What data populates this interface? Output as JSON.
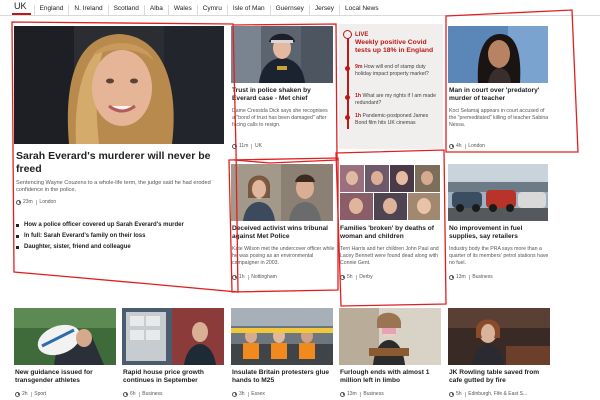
{
  "nav": {
    "current": "UK",
    "items": [
      "England",
      "N. Ireland",
      "Scotland",
      "Alba",
      "Wales",
      "Cymru",
      "Isle of Man",
      "Guernsey",
      "Jersey",
      "Local News"
    ]
  },
  "main_story": {
    "headline": "Sarah Everard's murderer will never be freed",
    "summary": "Sentencing Wayne Couzens to a whole-life term, the judge said he had eroded confidence in the police.",
    "time": "23m",
    "section": "London",
    "related": [
      "How a police officer covered up Sarah Everard's murder",
      "In full: Sarah Everard's family on their loss",
      "Daughter, sister, friend and colleague"
    ]
  },
  "story_trust": {
    "headline": "Trust in police shaken by Everard case - Met chief",
    "summary": "Dame Cressida Dick says she recognises a \"bond of trust has been damaged\" after facing calls to resign.",
    "time": "11m",
    "section": "UK"
  },
  "live": {
    "label": "LIVE",
    "title": "Weekly positive Covid tests up 18% in England",
    "updates": [
      {
        "time": "9m",
        "text": "How will end of stamp duty holiday impact property market?"
      },
      {
        "time": "1h",
        "text": "What are my rights if I am made redundant?"
      },
      {
        "time": "1h",
        "text": "Pandemic-postponed James Bond film hits UK cinemas"
      }
    ]
  },
  "story_court": {
    "headline": "Man in court over 'predatory' murder of teacher",
    "summary": "Koci Selamaj appears in court accused of the \"premeditated\" killing of teacher Sabina Nessa.",
    "time": "4h",
    "section": "London"
  },
  "story_activist": {
    "headline": "Deceived activist wins tribunal against Met Police",
    "summary": "Kate Wilson met the undercover officer while he was posing as an environmental campaigner in 2003.",
    "time": "1h",
    "section": "Nottingham"
  },
  "story_families": {
    "headline": "Families 'broken' by deaths of woman and children",
    "summary": "Terri Harris and her children John Paul and Lacey Bennett were found dead along with Connie Gent.",
    "time": "5h",
    "section": "Derby"
  },
  "story_fuel": {
    "headline": "No improvement in fuel supplies, say retailers",
    "summary": "Industry body the PRA says more than a quarter of its members' petrol stations have no fuel.",
    "time": "13m",
    "section": "Business"
  },
  "bottom": [
    {
      "headline": "New guidance issued for transgender athletes",
      "time": "2h",
      "section": "Sport"
    },
    {
      "headline": "Rapid house price growth continues in September",
      "time": "6h",
      "section": "Business"
    },
    {
      "headline": "Insulate Britain protesters glue hands to M25",
      "time": "3h",
      "section": "Essex"
    },
    {
      "headline": "Furlough ends with almost 1 million left in limbo",
      "time": "13m",
      "section": "Business"
    },
    {
      "headline": "JK Rowling table saved from cafe gutted by fire",
      "time": "5h",
      "section": "Edinburgh, Fife & East S..."
    }
  ],
  "colors": {
    "bbc_red": "#bb1919",
    "annotation_red": "#e02020",
    "live_panel_bg": "#f1efed"
  }
}
